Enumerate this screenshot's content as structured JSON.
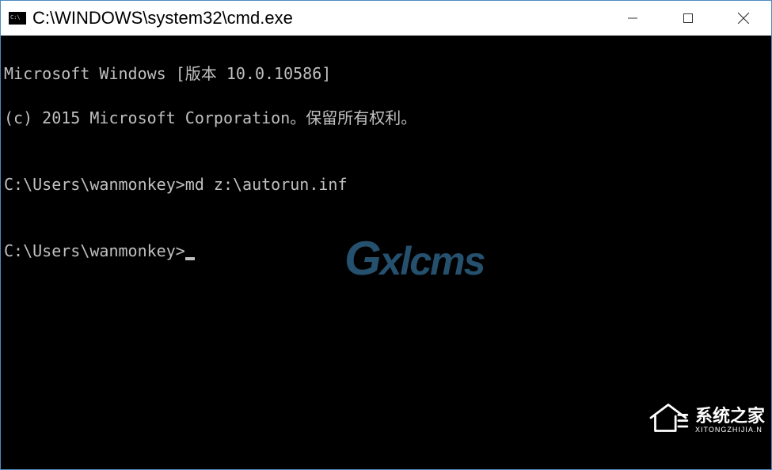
{
  "window": {
    "title": "C:\\WINDOWS\\system32\\cmd.exe"
  },
  "terminal": {
    "line1": "Microsoft Windows [版本 10.0.10586]",
    "line2": "(c) 2015 Microsoft Corporation。保留所有权利。",
    "blank1": "",
    "prompt1_path": "C:\\Users\\wanmonkey>",
    "prompt1_cmd": "md z:\\autorun.inf",
    "blank2": "",
    "prompt2_path": "C:\\Users\\wanmonkey>"
  },
  "watermark": {
    "center": "Gxlcms",
    "bottom_main": "系统之家",
    "bottom_sub": "XITONGZHIJIA.N"
  }
}
